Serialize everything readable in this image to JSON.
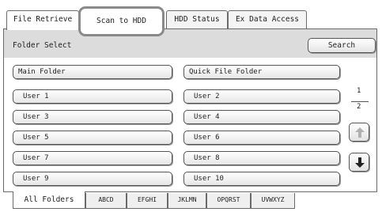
{
  "tabs": {
    "file_retrieve": "File Retrieve",
    "scan_to_hdd": "Scan to HDD",
    "hdd_status": "HDD Status",
    "ex_data_access": "Ex Data Access"
  },
  "header": {
    "title": "Folder Select",
    "search_label": "Search"
  },
  "folders": {
    "main": "Main Folder",
    "quick": "Quick File Folder",
    "users": [
      "User 1",
      "User 2",
      "User 3",
      "User 4",
      "User 5",
      "User 6",
      "User 7",
      "User 8",
      "User 9",
      "User 10"
    ]
  },
  "pagination": {
    "current": "1",
    "total": "2",
    "up_icon": "arrow-up-icon",
    "down_icon": "arrow-down-icon"
  },
  "index_tabs": [
    "All Folders",
    "ABCD",
    "EFGHI",
    "JKLMN",
    "OPQRST",
    "UVWXYZ"
  ],
  "colors": {
    "header_bar": "#dcdcdc",
    "border": "#6a6a6a",
    "highlight_ring": "#8a8a8a"
  }
}
